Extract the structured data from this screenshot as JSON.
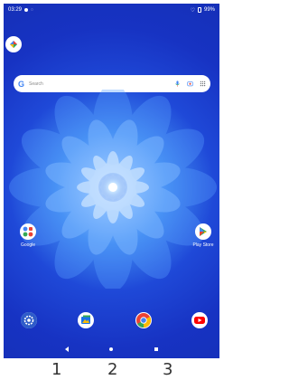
{
  "status_bar": {
    "time": "03:29",
    "battery": "99%"
  },
  "search": {
    "placeholder": "Search",
    "google_glyph": "G"
  },
  "apps": {
    "google": {
      "label": "Google",
      "icon": "google-folder-icon"
    },
    "play_store": {
      "label": "Play Store",
      "icon": "play-store-icon"
    }
  },
  "dock": [
    {
      "name": "settings",
      "icon": "settings-icon"
    },
    {
      "name": "gallery",
      "icon": "gallery-icon"
    },
    {
      "name": "chrome",
      "icon": "chrome-icon"
    },
    {
      "name": "youtube",
      "icon": "youtube-icon"
    }
  ],
  "nav": {
    "back": "back-icon",
    "home": "home-icon",
    "recents": "recents-icon"
  },
  "numbers": [
    "1",
    "2",
    "3"
  ],
  "colors": {
    "wallpaper_dark": "#1530b8",
    "wallpaper_mid": "#3f8af0",
    "wallpaper_light": "#e9f3ff",
    "youtube_red": "#ff0000",
    "settings_blue": "#2e5cc9"
  }
}
